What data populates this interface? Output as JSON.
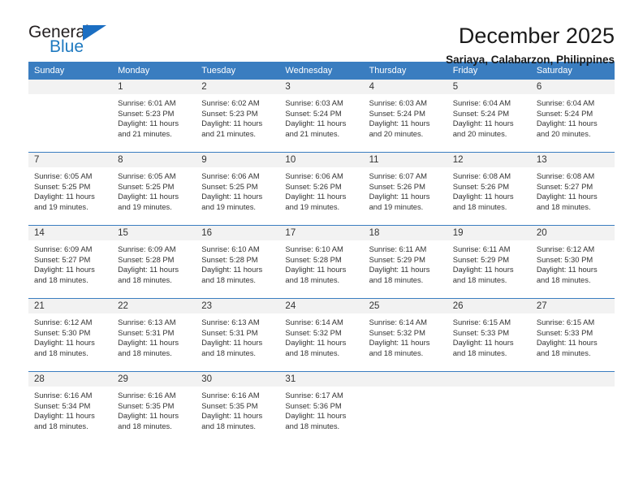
{
  "logo": {
    "word_top": "General",
    "word_bottom": "Blue",
    "triangle_icon": "blue-triangle-icon",
    "accent_color": "#1b6ec2"
  },
  "header": {
    "title": "December 2025",
    "subtitle": "Sariaya, Calabarzon, Philippines"
  },
  "theme": {
    "header_blue": "#3a7dc0",
    "daynum_gray": "#f2f2f2",
    "text": "#333333"
  },
  "weekdays": [
    "Sunday",
    "Monday",
    "Tuesday",
    "Wednesday",
    "Thursday",
    "Friday",
    "Saturday"
  ],
  "weeks": [
    [
      {
        "day": "",
        "sunrise": "",
        "sunset": "",
        "daylight": ""
      },
      {
        "day": "1",
        "sunrise": "Sunrise: 6:01 AM",
        "sunset": "Sunset: 5:23 PM",
        "daylight": "Daylight: 11 hours and 21 minutes."
      },
      {
        "day": "2",
        "sunrise": "Sunrise: 6:02 AM",
        "sunset": "Sunset: 5:23 PM",
        "daylight": "Daylight: 11 hours and 21 minutes."
      },
      {
        "day": "3",
        "sunrise": "Sunrise: 6:03 AM",
        "sunset": "Sunset: 5:24 PM",
        "daylight": "Daylight: 11 hours and 21 minutes."
      },
      {
        "day": "4",
        "sunrise": "Sunrise: 6:03 AM",
        "sunset": "Sunset: 5:24 PM",
        "daylight": "Daylight: 11 hours and 20 minutes."
      },
      {
        "day": "5",
        "sunrise": "Sunrise: 6:04 AM",
        "sunset": "Sunset: 5:24 PM",
        "daylight": "Daylight: 11 hours and 20 minutes."
      },
      {
        "day": "6",
        "sunrise": "Sunrise: 6:04 AM",
        "sunset": "Sunset: 5:24 PM",
        "daylight": "Daylight: 11 hours and 20 minutes."
      }
    ],
    [
      {
        "day": "7",
        "sunrise": "Sunrise: 6:05 AM",
        "sunset": "Sunset: 5:25 PM",
        "daylight": "Daylight: 11 hours and 19 minutes."
      },
      {
        "day": "8",
        "sunrise": "Sunrise: 6:05 AM",
        "sunset": "Sunset: 5:25 PM",
        "daylight": "Daylight: 11 hours and 19 minutes."
      },
      {
        "day": "9",
        "sunrise": "Sunrise: 6:06 AM",
        "sunset": "Sunset: 5:25 PM",
        "daylight": "Daylight: 11 hours and 19 minutes."
      },
      {
        "day": "10",
        "sunrise": "Sunrise: 6:06 AM",
        "sunset": "Sunset: 5:26 PM",
        "daylight": "Daylight: 11 hours and 19 minutes."
      },
      {
        "day": "11",
        "sunrise": "Sunrise: 6:07 AM",
        "sunset": "Sunset: 5:26 PM",
        "daylight": "Daylight: 11 hours and 19 minutes."
      },
      {
        "day": "12",
        "sunrise": "Sunrise: 6:08 AM",
        "sunset": "Sunset: 5:26 PM",
        "daylight": "Daylight: 11 hours and 18 minutes."
      },
      {
        "day": "13",
        "sunrise": "Sunrise: 6:08 AM",
        "sunset": "Sunset: 5:27 PM",
        "daylight": "Daylight: 11 hours and 18 minutes."
      }
    ],
    [
      {
        "day": "14",
        "sunrise": "Sunrise: 6:09 AM",
        "sunset": "Sunset: 5:27 PM",
        "daylight": "Daylight: 11 hours and 18 minutes."
      },
      {
        "day": "15",
        "sunrise": "Sunrise: 6:09 AM",
        "sunset": "Sunset: 5:28 PM",
        "daylight": "Daylight: 11 hours and 18 minutes."
      },
      {
        "day": "16",
        "sunrise": "Sunrise: 6:10 AM",
        "sunset": "Sunset: 5:28 PM",
        "daylight": "Daylight: 11 hours and 18 minutes."
      },
      {
        "day": "17",
        "sunrise": "Sunrise: 6:10 AM",
        "sunset": "Sunset: 5:28 PM",
        "daylight": "Daylight: 11 hours and 18 minutes."
      },
      {
        "day": "18",
        "sunrise": "Sunrise: 6:11 AM",
        "sunset": "Sunset: 5:29 PM",
        "daylight": "Daylight: 11 hours and 18 minutes."
      },
      {
        "day": "19",
        "sunrise": "Sunrise: 6:11 AM",
        "sunset": "Sunset: 5:29 PM",
        "daylight": "Daylight: 11 hours and 18 minutes."
      },
      {
        "day": "20",
        "sunrise": "Sunrise: 6:12 AM",
        "sunset": "Sunset: 5:30 PM",
        "daylight": "Daylight: 11 hours and 18 minutes."
      }
    ],
    [
      {
        "day": "21",
        "sunrise": "Sunrise: 6:12 AM",
        "sunset": "Sunset: 5:30 PM",
        "daylight": "Daylight: 11 hours and 18 minutes."
      },
      {
        "day": "22",
        "sunrise": "Sunrise: 6:13 AM",
        "sunset": "Sunset: 5:31 PM",
        "daylight": "Daylight: 11 hours and 18 minutes."
      },
      {
        "day": "23",
        "sunrise": "Sunrise: 6:13 AM",
        "sunset": "Sunset: 5:31 PM",
        "daylight": "Daylight: 11 hours and 18 minutes."
      },
      {
        "day": "24",
        "sunrise": "Sunrise: 6:14 AM",
        "sunset": "Sunset: 5:32 PM",
        "daylight": "Daylight: 11 hours and 18 minutes."
      },
      {
        "day": "25",
        "sunrise": "Sunrise: 6:14 AM",
        "sunset": "Sunset: 5:32 PM",
        "daylight": "Daylight: 11 hours and 18 minutes."
      },
      {
        "day": "26",
        "sunrise": "Sunrise: 6:15 AM",
        "sunset": "Sunset: 5:33 PM",
        "daylight": "Daylight: 11 hours and 18 minutes."
      },
      {
        "day": "27",
        "sunrise": "Sunrise: 6:15 AM",
        "sunset": "Sunset: 5:33 PM",
        "daylight": "Daylight: 11 hours and 18 minutes."
      }
    ],
    [
      {
        "day": "28",
        "sunrise": "Sunrise: 6:16 AM",
        "sunset": "Sunset: 5:34 PM",
        "daylight": "Daylight: 11 hours and 18 minutes."
      },
      {
        "day": "29",
        "sunrise": "Sunrise: 6:16 AM",
        "sunset": "Sunset: 5:35 PM",
        "daylight": "Daylight: 11 hours and 18 minutes."
      },
      {
        "day": "30",
        "sunrise": "Sunrise: 6:16 AM",
        "sunset": "Sunset: 5:35 PM",
        "daylight": "Daylight: 11 hours and 18 minutes."
      },
      {
        "day": "31",
        "sunrise": "Sunrise: 6:17 AM",
        "sunset": "Sunset: 5:36 PM",
        "daylight": "Daylight: 11 hours and 18 minutes."
      },
      {
        "day": "",
        "sunrise": "",
        "sunset": "",
        "daylight": ""
      },
      {
        "day": "",
        "sunrise": "",
        "sunset": "",
        "daylight": ""
      },
      {
        "day": "",
        "sunrise": "",
        "sunset": "",
        "daylight": ""
      }
    ]
  ]
}
